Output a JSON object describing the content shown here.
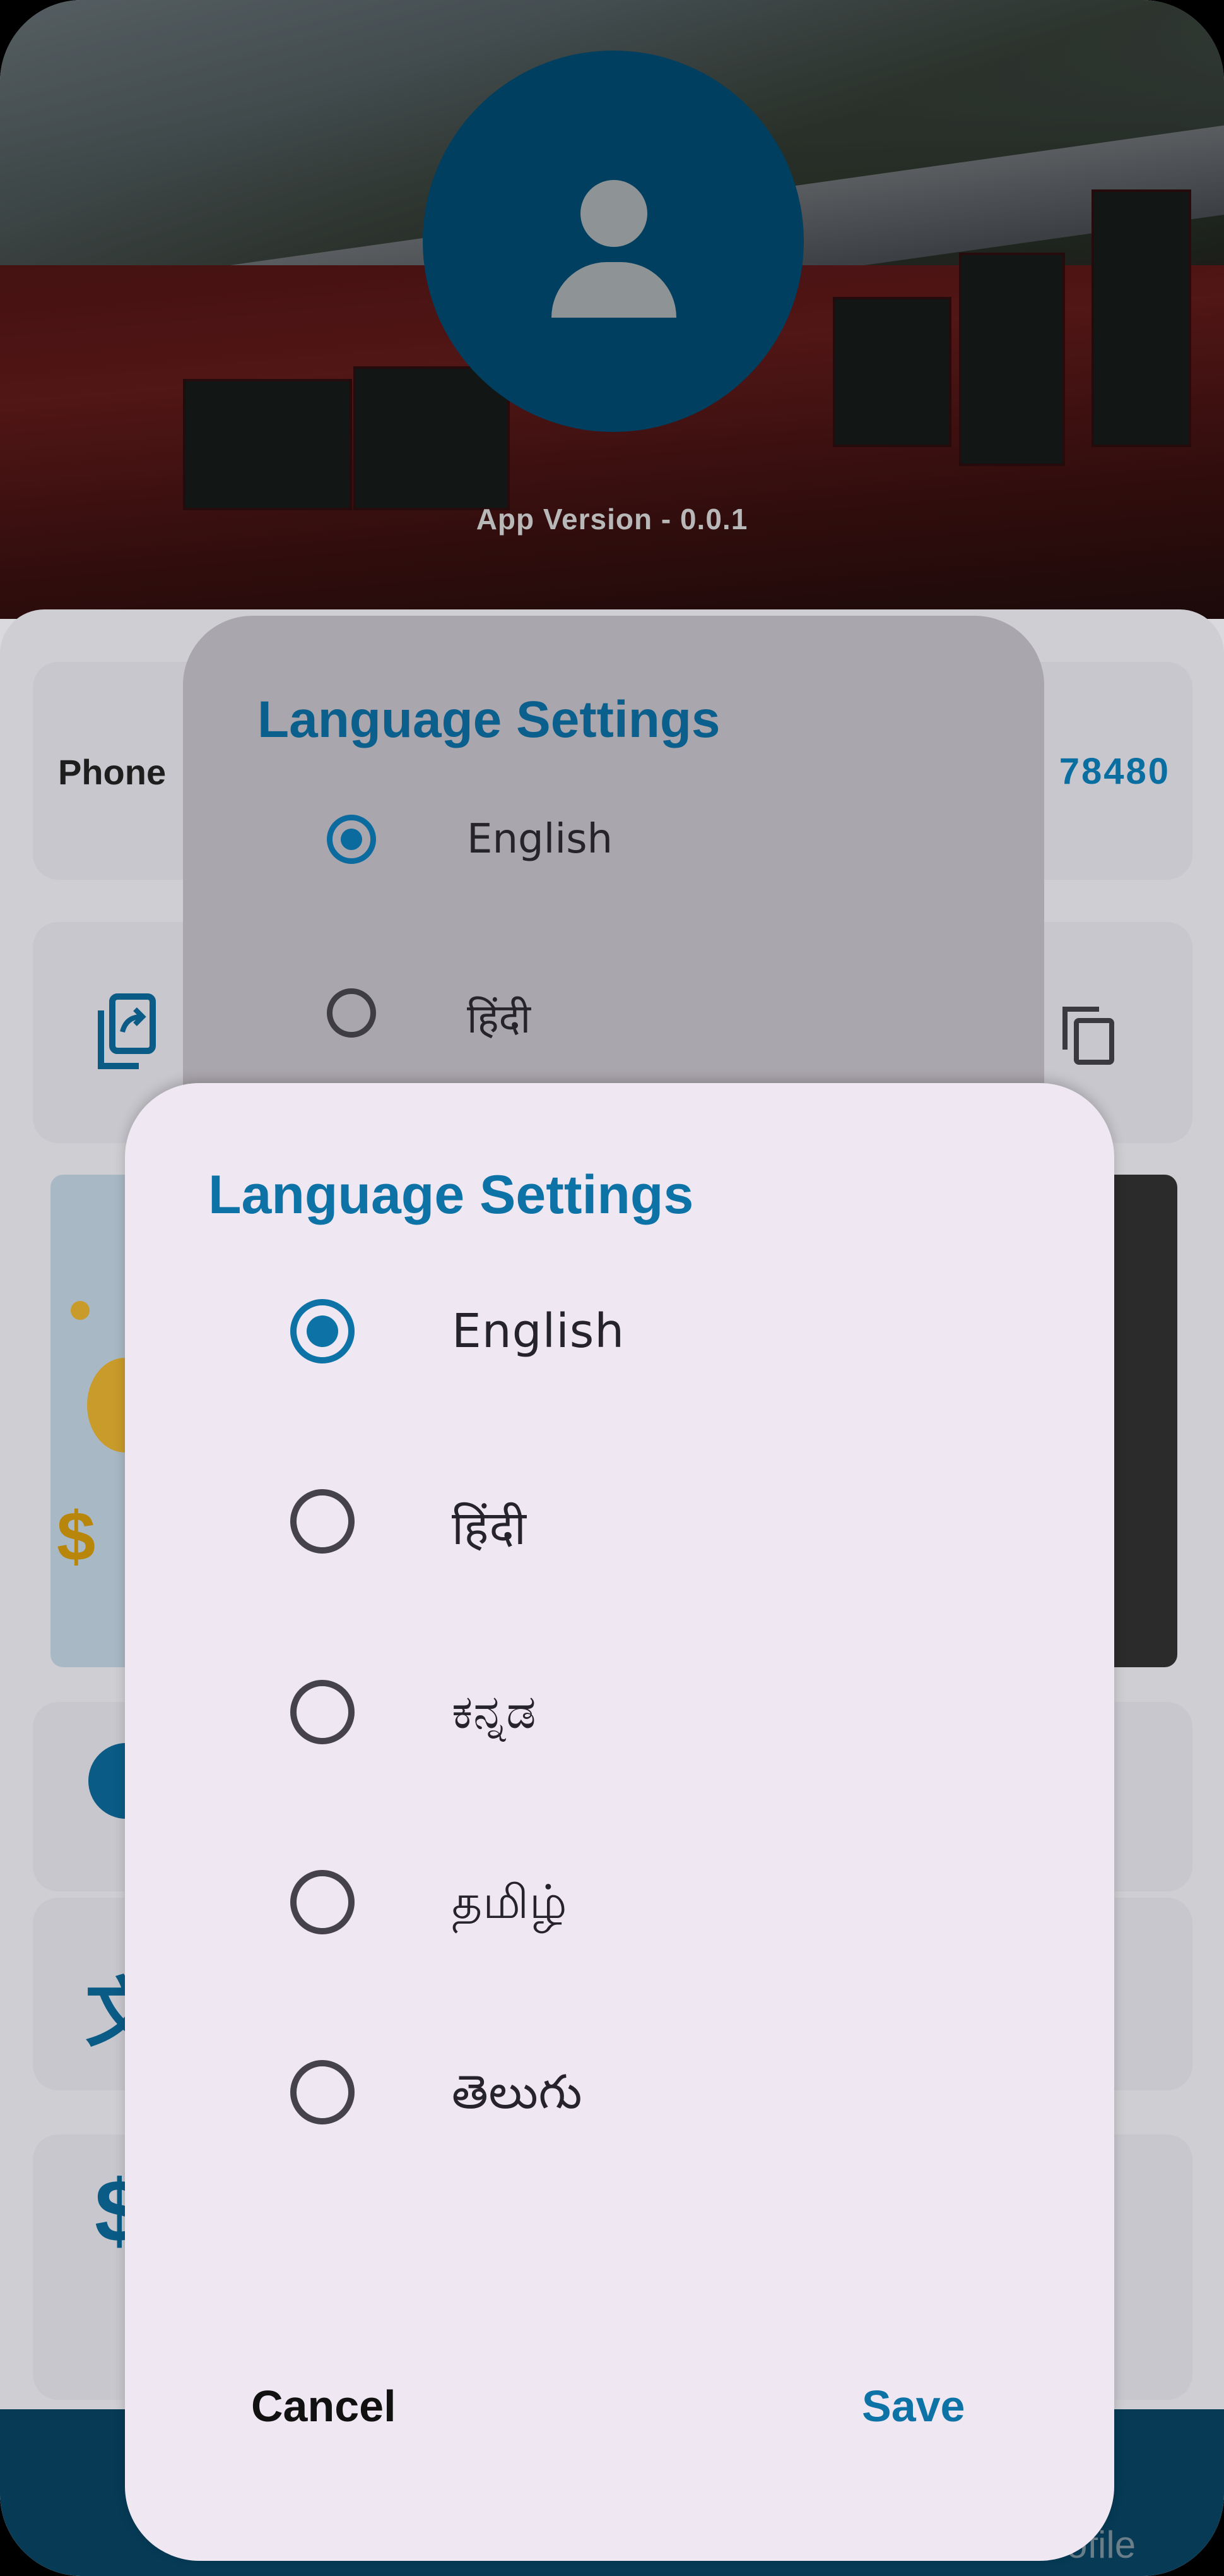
{
  "header": {
    "app_version": "App Version - 0.0.1"
  },
  "profile_card": {
    "phone_label": "Phone",
    "phone_value_partial": "78480"
  },
  "bottom_nav": {
    "profile_label": "Profile"
  },
  "back_dialog": {
    "title": "Language Settings",
    "options": [
      {
        "label": "English",
        "selected": true
      },
      {
        "label": "हिंदी",
        "selected": false
      }
    ]
  },
  "language_dialog": {
    "title": "Language Settings",
    "options": [
      {
        "label": "English",
        "selected": true
      },
      {
        "label": "हिंदी",
        "selected": false
      },
      {
        "label": "ಕನ್ನಡ",
        "selected": false
      },
      {
        "label": "தமிழ்",
        "selected": false
      },
      {
        "label": "తెలుగు",
        "selected": false
      }
    ],
    "cancel_label": "Cancel",
    "save_label": "Save"
  },
  "colors": {
    "accent": "#0d72a6",
    "avatar_bg": "#003f5f",
    "nav_bg": "#063a55",
    "dialog_bg": "#efe8f2"
  },
  "icons": [
    "user-icon",
    "share-icon",
    "copy-icon",
    "radio-icon"
  ]
}
